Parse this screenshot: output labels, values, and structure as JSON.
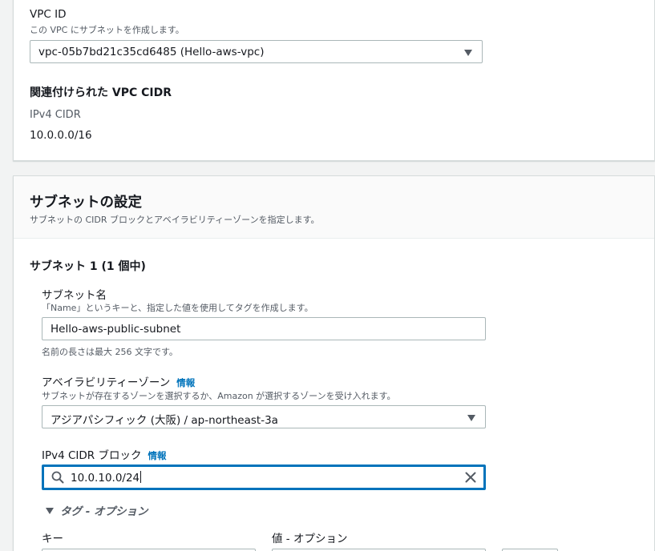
{
  "vpc_section": {
    "vpc_id_label": "VPC ID",
    "vpc_id_desc": "この VPC にサブネットを作成します。",
    "vpc_id_value": "vpc-05b7bd21c35cd6485 (Hello-aws-vpc)",
    "cidr_heading": "関連付けられた VPC CIDR",
    "ipv4_cidr_label": "IPv4 CIDR",
    "ipv4_cidr_value": "10.0.0.0/16"
  },
  "subnet_settings": {
    "title": "サブネットの設定",
    "description": "サブネットの CIDR ブロックとアベイラビリティーゾーンを指定します。",
    "subnet_heading": "サブネット 1 (1 個中)",
    "name_label": "サブネット名",
    "name_desc": "「Name」というキーと、指定した値を使用してタグを作成します。",
    "name_value": "Hello-aws-public-subnet",
    "name_hint": "名前の長さは最大 256 文字です。",
    "az_label": "アベイラビリティーゾーン",
    "az_info": "情報",
    "az_desc": "サブネットが存在するゾーンを選択するか、Amazon が選択するゾーンを受け入れます。",
    "az_value": "アジアパシフィック (大阪) / ap-northeast-3a",
    "cidr_block_label": "IPv4 CIDR ブロック",
    "cidr_block_info": "情報",
    "cidr_block_value": "10.0.10.0/24",
    "tags_toggle": "タグ - オプション",
    "key_label": "キー",
    "value_label": "値 - オプション"
  },
  "icons": {
    "search": "search-icon",
    "clear": "close-icon",
    "caret": "caret-down-icon"
  },
  "colors": {
    "accent": "#0073bb",
    "border": "#aab7b8",
    "background": "#f2f3f3"
  }
}
